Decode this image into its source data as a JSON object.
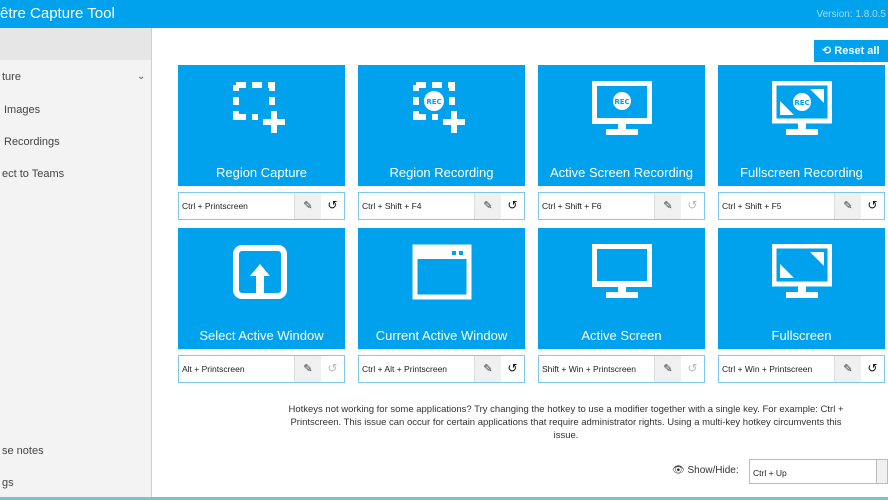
{
  "window": {
    "title": "être Capture Tool",
    "version": "Version: 1.8.0.5"
  },
  "sidebar": {
    "items": [
      {
        "label": "ture"
      },
      {
        "label": "Images"
      },
      {
        "label": "Recordings"
      },
      {
        "label": "ect to Teams"
      },
      {
        "label": "se notes"
      },
      {
        "label": "gs"
      }
    ]
  },
  "toolbar": {
    "reset_label": "Reset all"
  },
  "tiles": [
    {
      "label": "Region Capture",
      "hotkey": "Ctrl + Printscreen",
      "reset_enabled": true
    },
    {
      "label": "Region Recording",
      "hotkey": "Ctrl + Shift + F4",
      "reset_enabled": true
    },
    {
      "label": "Active Screen Recording",
      "hotkey": "Ctrl + Shift + F6",
      "reset_enabled": false
    },
    {
      "label": "Fullscreen Recording",
      "hotkey": "Ctrl + Shift + F5",
      "reset_enabled": true
    },
    {
      "label": "Select Active Window",
      "hotkey": "Alt + Printscreen",
      "reset_enabled": false
    },
    {
      "label": "Current Active Window",
      "hotkey": "Ctrl + Alt + Printscreen",
      "reset_enabled": true
    },
    {
      "label": "Active Screen",
      "hotkey": "Shift + Win + Printscreen",
      "reset_enabled": false
    },
    {
      "label": "Fullscreen",
      "hotkey": "Ctrl + Win + Printscreen",
      "reset_enabled": true
    }
  ],
  "note": "Hotkeys not working for some applications? Try changing the hotkey to use a modifier together with a single key. For example: Ctrl + Printscreen. This issue can occur for certain applications that require administrator rights. Using a multi-key hotkey circumvents this issue.",
  "show_hide": {
    "label": "Show/Hide:",
    "value": "Ctrl + Up"
  },
  "colors": {
    "accent": "#00a2ed"
  }
}
